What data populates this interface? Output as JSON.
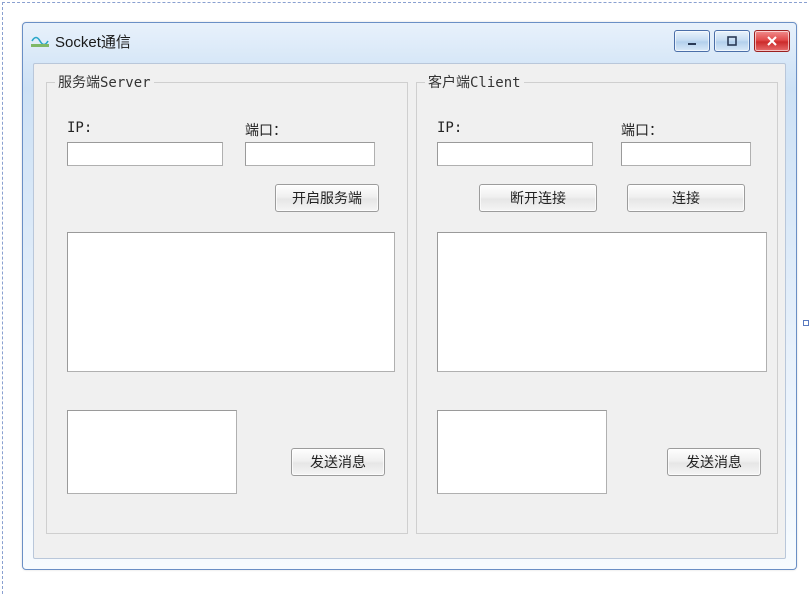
{
  "window": {
    "title": "Socket通信"
  },
  "server": {
    "legend": "服务端Server",
    "ip_label": "IP:",
    "port_label": "端口：",
    "ip_value": "",
    "port_value": "",
    "start_button": "开启服务端",
    "log_value": "",
    "send_value": "",
    "send_button": "发送消息"
  },
  "client": {
    "legend": "客户端Client",
    "ip_label": "IP:",
    "port_label": "端口：",
    "ip_value": "",
    "port_value": "",
    "disconnect_button": "断开连接",
    "connect_button": "连接",
    "log_value": "",
    "send_value": "",
    "send_button": "发送消息"
  }
}
